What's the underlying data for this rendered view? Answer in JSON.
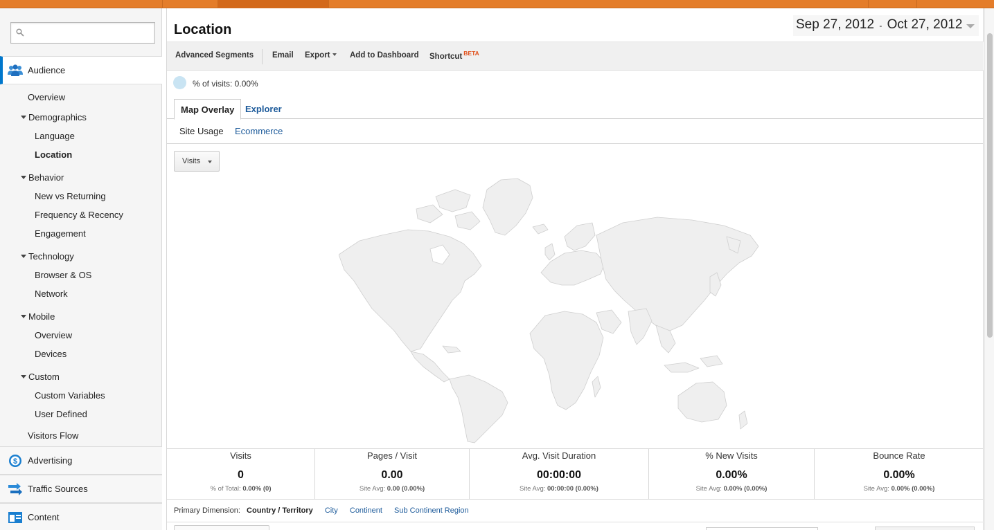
{
  "search": {
    "placeholder": "",
    "value": ""
  },
  "sidebar": {
    "audience": "Audience",
    "audience_items": {
      "overview": "Overview",
      "demographics": "Demographics",
      "language": "Language",
      "location": "Location",
      "behavior": "Behavior",
      "new_vs_returning": "New vs Returning",
      "frequency_recency": "Frequency & Recency",
      "engagement": "Engagement",
      "technology": "Technology",
      "browser_os": "Browser & OS",
      "network": "Network",
      "mobile": "Mobile",
      "mobile_overview": "Overview",
      "devices": "Devices",
      "custom": "Custom",
      "custom_variables": "Custom Variables",
      "user_defined": "User Defined",
      "visitors_flow": "Visitors Flow"
    },
    "advertising": "Advertising",
    "traffic_sources": "Traffic Sources",
    "content": "Content"
  },
  "header": {
    "title": "Location",
    "date_start": "Sep 27, 2012",
    "date_sep": "-",
    "date_end": "Oct 27, 2012"
  },
  "toolbar": {
    "advanced_segments": "Advanced Segments",
    "email": "Email",
    "export": "Export",
    "add_to_dashboard": "Add to Dashboard",
    "shortcut": "Shortcut",
    "beta": "BETA"
  },
  "segment": {
    "text": "% of visits: 0.00%"
  },
  "tabs": {
    "map_overlay": "Map Overlay",
    "explorer": "Explorer"
  },
  "subtabs": {
    "site_usage": "Site Usage",
    "ecommerce": "Ecommerce"
  },
  "metric_select": {
    "value": "Visits"
  },
  "scorecards": [
    {
      "name": "Visits",
      "value": "0",
      "sub_label": "% of Total:",
      "sub_value": "0.00% (0)"
    },
    {
      "name": "Pages / Visit",
      "value": "0.00",
      "sub_label": "Site Avg:",
      "sub_value": "0.00 (0.00%)"
    },
    {
      "name": "Avg. Visit Duration",
      "value": "00:00:00",
      "sub_label": "Site Avg:",
      "sub_value": "00:00:00 (0.00%)"
    },
    {
      "name": "% New Visits",
      "value": "0.00%",
      "sub_label": "Site Avg:",
      "sub_value": "0.00% (0.00%)"
    },
    {
      "name": "Bounce Rate",
      "value": "0.00%",
      "sub_label": "Site Avg:",
      "sub_value": "0.00% (0.00%)"
    }
  ],
  "primary_dimension": {
    "label": "Primary Dimension:",
    "active": "Country / Territory",
    "options": [
      "City",
      "Continent",
      "Sub Continent Region"
    ]
  },
  "colors": {
    "top_bar": "#e47d2a",
    "accent": "#0077cc",
    "link": "#1c5a9a",
    "map_land": "#efefef",
    "map_border": "#cfcfcf"
  }
}
